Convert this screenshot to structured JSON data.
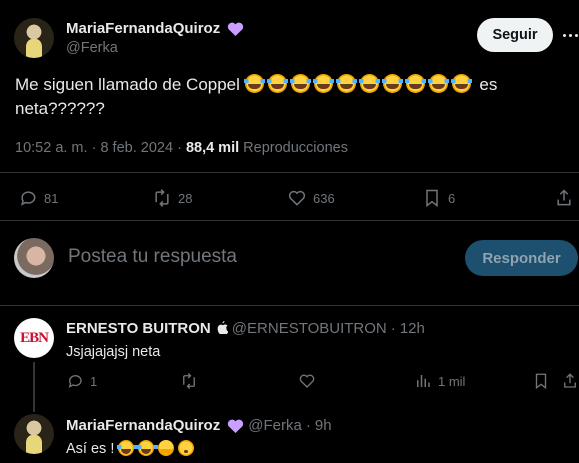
{
  "tweet": {
    "author_name": "MariaFernandaQuiroz",
    "author_handle": "@Ferka",
    "follow_label": "Seguir",
    "text_before": "Me siguen llamado de Coppel",
    "text_after": "es",
    "text_line2": "neta??????",
    "time": "10:52 a. m.",
    "separator": "·",
    "date": "8 feb. 2024",
    "views": "88,4 mil",
    "views_label": "Reproducciones",
    "stats": {
      "replies": "81",
      "retweets": "28",
      "likes": "636",
      "bookmarks": "6"
    }
  },
  "compose": {
    "placeholder": "Postea tu respuesta",
    "button_label": "Responder"
  },
  "replies": [
    {
      "logo_text": "EBN",
      "author_name": "ERNESTO BUITRON",
      "author_handle": "@ERNESTOBUITRON",
      "separator": "·",
      "time": "12h",
      "text": "Jsjajajajsj neta",
      "stats": {
        "replies": "1",
        "views": "1 mil"
      }
    },
    {
      "author_name": "MariaFernandaQuiroz",
      "author_handle": "@Ferka",
      "separator": "·",
      "time": "9h",
      "text": "Así es !"
    }
  ],
  "colors": {
    "background": "#000000",
    "text": "#e7e9ea",
    "muted": "#71767b",
    "verified_purple": "#c9a0ff",
    "accent_blue": "#1d9bf0"
  },
  "icons": [
    "verified-heart-icon",
    "more-icon",
    "reply-icon",
    "retweet-icon",
    "like-icon",
    "bookmark-icon",
    "share-icon",
    "views-icon",
    "apple-icon"
  ]
}
